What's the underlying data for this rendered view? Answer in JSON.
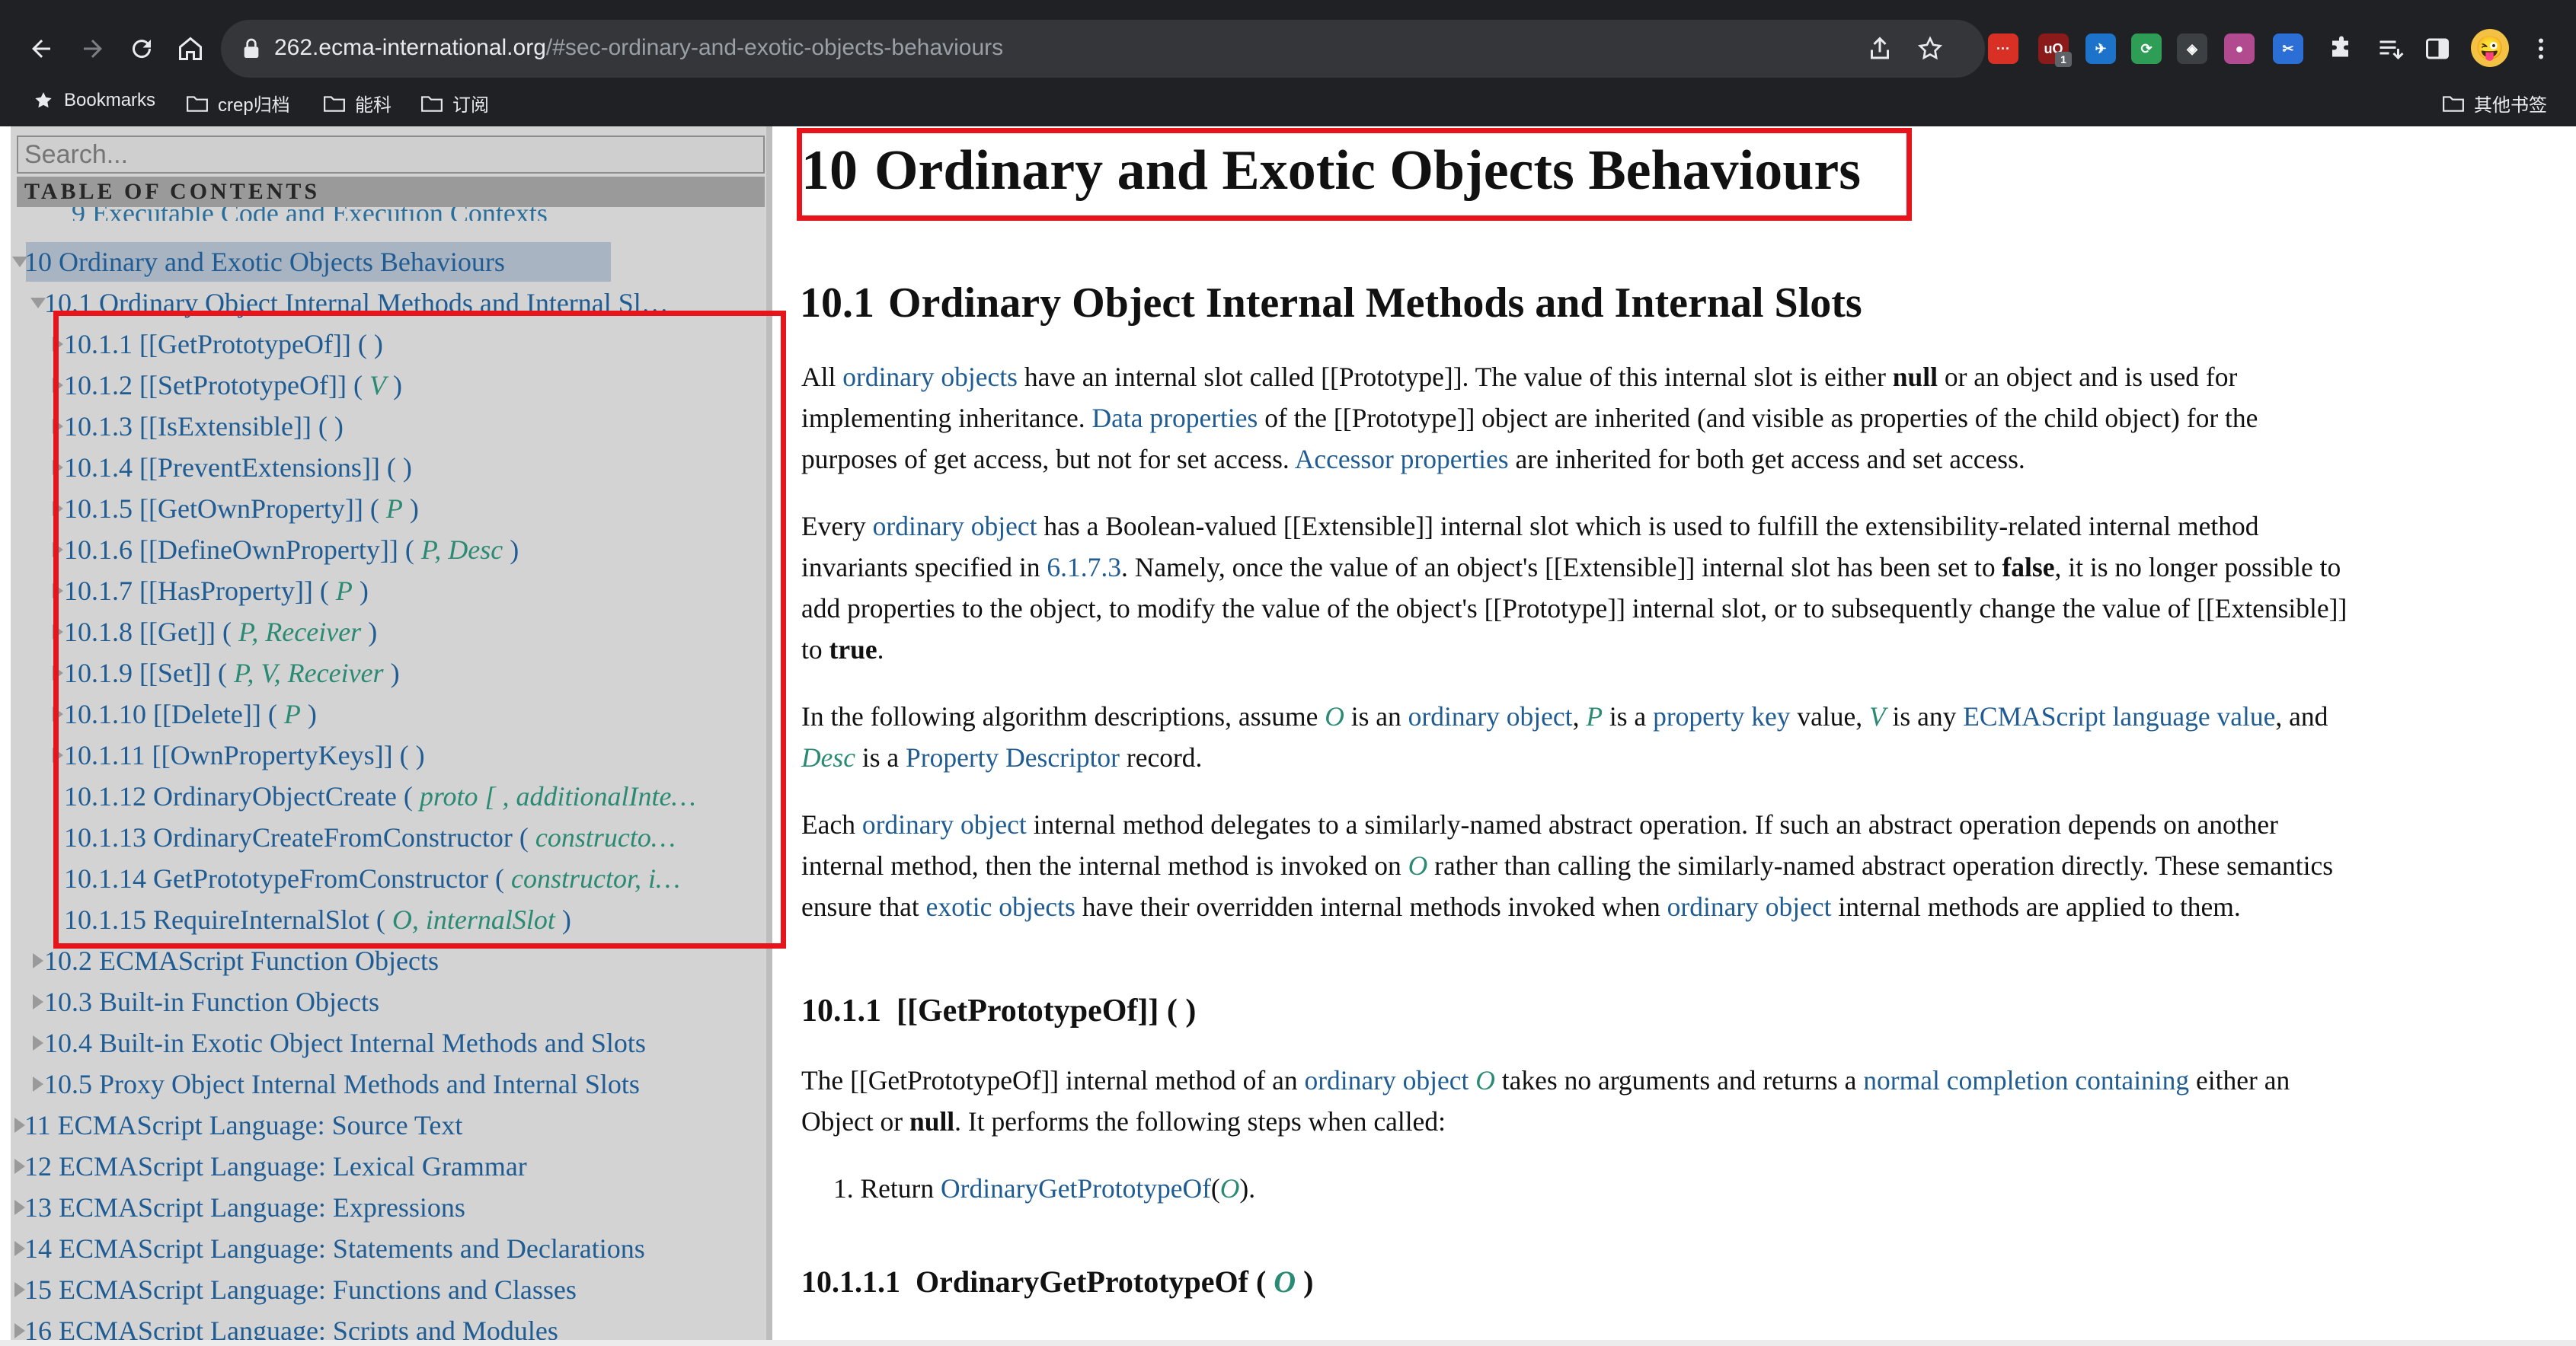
{
  "browser": {
    "url_host": "262.ecma-international.org",
    "url_path": "/#sec-ordinary-and-exotic-objects-behaviours",
    "extension_badge": "1",
    "extensions": [
      {
        "name": "extension-red",
        "label": "···",
        "color": "#d93025"
      },
      {
        "name": "extension-ublock",
        "label": "uO",
        "color": "#8b1a1a"
      },
      {
        "name": "extension-blue-bird",
        "label": "✈",
        "color": "#1d72c9"
      },
      {
        "name": "extension-green-swirl",
        "label": "⟳",
        "color": "#2e9e57"
      },
      {
        "name": "extension-dark-square",
        "label": "◈",
        "color": "#3c4043"
      },
      {
        "name": "extension-pink-dot",
        "label": "●",
        "color": "#b14a8f"
      },
      {
        "name": "extension-scissors",
        "label": "✂",
        "color": "#2b6fd6"
      }
    ],
    "avatar": "😜",
    "bookmarks": [
      {
        "label": "Bookmarks",
        "icon": "star-icon"
      },
      {
        "label": "crep归档",
        "icon": "folder-icon"
      },
      {
        "label": "能科",
        "icon": "folder-icon"
      },
      {
        "label": "订阅",
        "icon": "folder-icon"
      }
    ],
    "other_bookmarks": "其他书签"
  },
  "sidebar": {
    "search_placeholder": "Search...",
    "toc_title": "TABLE OF CONTENTS",
    "cut_item": "9 Executable Code and Execution Contexts",
    "items": [
      {
        "number": "10",
        "title": "Ordinary and Exotic Objects Behaviours",
        "level": 0,
        "arrow": "expanded",
        "active": true
      },
      {
        "number": "10.1",
        "title": "Ordinary Object Internal Methods and Internal Sl…",
        "level": 1,
        "arrow": "expanded"
      },
      {
        "number": "10.1.1",
        "title": "[[GetPrototypeOf]]",
        "args": "( )",
        "level": 2,
        "arrow": "collapsed"
      },
      {
        "number": "10.1.2",
        "title": "[[SetPrototypeOf]]",
        "args_open": "( ",
        "params": "V",
        "args_close": " )",
        "level": 2,
        "arrow": "collapsed"
      },
      {
        "number": "10.1.3",
        "title": "[[IsExtensible]]",
        "args": "( )",
        "level": 2,
        "arrow": "collapsed"
      },
      {
        "number": "10.1.4",
        "title": "[[PreventExtensions]]",
        "args": "( )",
        "level": 2,
        "arrow": "collapsed"
      },
      {
        "number": "10.1.5",
        "title": "[[GetOwnProperty]]",
        "args_open": "( ",
        "params": "P",
        "args_close": " )",
        "level": 2,
        "arrow": "collapsed"
      },
      {
        "number": "10.1.6",
        "title": "[[DefineOwnProperty]]",
        "args_open": "( ",
        "params": "P, Desc",
        "args_close": " )",
        "level": 2,
        "arrow": "collapsed"
      },
      {
        "number": "10.1.7",
        "title": "[[HasProperty]]",
        "args_open": "( ",
        "params": "P",
        "args_close": " )",
        "level": 2,
        "arrow": "collapsed"
      },
      {
        "number": "10.1.8",
        "title": "[[Get]]",
        "args_open": "( ",
        "params": "P, Receiver",
        "args_close": " )",
        "level": 2,
        "arrow": "collapsed"
      },
      {
        "number": "10.1.9",
        "title": "[[Set]]",
        "args_open": "( ",
        "params": "P, V, Receiver",
        "args_close": " )",
        "level": 2,
        "arrow": "collapsed"
      },
      {
        "number": "10.1.10",
        "title": "[[Delete]]",
        "args_open": "( ",
        "params": "P",
        "args_close": " )",
        "level": 2,
        "arrow": "collapsed"
      },
      {
        "number": "10.1.11",
        "title": "[[OwnPropertyKeys]]",
        "args": "( )",
        "level": 2,
        "arrow": "collapsed"
      },
      {
        "number": "10.1.12",
        "title": "OrdinaryObjectCreate",
        "args_open": "( ",
        "params": "proto [ , additionalInte…",
        "args_close": "",
        "level": 2,
        "arrow": "none"
      },
      {
        "number": "10.1.13",
        "title": "OrdinaryCreateFromConstructor",
        "args_open": "( ",
        "params": "constructo…",
        "args_close": "",
        "level": 2,
        "arrow": "none"
      },
      {
        "number": "10.1.14",
        "title": "GetPrototypeFromConstructor",
        "args_open": "( ",
        "params": "constructor, i…",
        "args_close": "",
        "level": 2,
        "arrow": "none"
      },
      {
        "number": "10.1.15",
        "title": "RequireInternalSlot",
        "args_open": "( ",
        "params": "O, internalSlot",
        "args_close": " )",
        "level": 2,
        "arrow": "none"
      },
      {
        "number": "10.2",
        "title": "ECMAScript Function Objects",
        "level": 1,
        "arrow": "collapsed"
      },
      {
        "number": "10.3",
        "title": "Built-in Function Objects",
        "level": 1,
        "arrow": "collapsed"
      },
      {
        "number": "10.4",
        "title": "Built-in Exotic Object Internal Methods and Slots",
        "level": 1,
        "arrow": "collapsed"
      },
      {
        "number": "10.5",
        "title": "Proxy Object Internal Methods and Internal Slots",
        "level": 1,
        "arrow": "collapsed"
      },
      {
        "number": "11",
        "title": "ECMAScript Language: Source Text",
        "level": 0,
        "arrow": "collapsed"
      },
      {
        "number": "12",
        "title": "ECMAScript Language: Lexical Grammar",
        "level": 0,
        "arrow": "collapsed"
      },
      {
        "number": "13",
        "title": "ECMAScript Language: Expressions",
        "level": 0,
        "arrow": "collapsed"
      },
      {
        "number": "14",
        "title": "ECMAScript Language: Statements and Declarations",
        "level": 0,
        "arrow": "collapsed"
      },
      {
        "number": "15",
        "title": "ECMAScript Language: Functions and Classes",
        "level": 0,
        "arrow": "collapsed"
      },
      {
        "number": "16",
        "title": "ECMAScript Language: Scripts and Modules",
        "level": 0,
        "arrow": "collapsed"
      }
    ]
  },
  "content": {
    "h1_number": "10",
    "h1_title": "Ordinary and Exotic Objects Behaviours",
    "h2_number": "10.1",
    "h2_title": "Ordinary Object Internal Methods and Internal Slots",
    "p1": [
      [
        "All ",
        {
          "link": "ordinary objects"
        },
        " have an internal slot called [[Prototype]]. The value of this internal slot is either ",
        {
          "bold": "null"
        },
        " or an object and is used for"
      ],
      [
        "implementing inheritance. ",
        {
          "link": "Data properties"
        },
        " of the [[Prototype]] object are inherited (and visible as properties of the child object) for the"
      ],
      [
        "purposes of get access, but not for set access. ",
        {
          "link": "Accessor properties"
        },
        " are inherited for both get access and set access."
      ]
    ],
    "p2": [
      [
        "Every ",
        {
          "link": "ordinary object"
        },
        " has a Boolean-valued [[Extensible]] internal slot which is used to fulfill the extensibility-related internal method"
      ],
      [
        "invariants specified in ",
        {
          "link": "6.1.7.3"
        },
        ". Namely, once the value of an object's [[Extensible]] internal slot has been set to ",
        {
          "bold": "false"
        },
        ", it is no longer possible to"
      ],
      [
        "add properties to the object, to modify the value of the object's [[Prototype]] internal slot, or to subsequently change the value of [[Extensible]]"
      ],
      [
        "to ",
        {
          "bold": "true"
        },
        "."
      ]
    ],
    "p3": [
      [
        "In the following algorithm descriptions, assume ",
        {
          "var": "O"
        },
        " is an ",
        {
          "link": "ordinary object"
        },
        ", ",
        {
          "var": "P"
        },
        " is a ",
        {
          "link": "property key"
        },
        " value, ",
        {
          "var": "V"
        },
        " is any ",
        {
          "link": "ECMAScript language value"
        },
        ", and"
      ],
      [
        {
          "var": "Desc"
        },
        " is a ",
        {
          "link": "Property Descriptor"
        },
        " record."
      ]
    ],
    "p4": [
      [
        "Each ",
        {
          "link": "ordinary object"
        },
        " internal method delegates to a similarly-named abstract operation. If such an abstract operation depends on another"
      ],
      [
        "internal method, then the internal method is invoked on ",
        {
          "var": "O"
        },
        " rather than calling the similarly-named abstract operation directly. These semantics"
      ],
      [
        "ensure that ",
        {
          "link": "exotic objects"
        },
        " have their overridden internal methods invoked when ",
        {
          "link": "ordinary object"
        },
        " internal methods are applied to them."
      ]
    ],
    "h3_number": "10.1.1",
    "h3_title": "[[GetPrototypeOf]] ( )",
    "p5": [
      [
        "The [[GetPrototypeOf]] internal method of an ",
        {
          "link": "ordinary object"
        },
        " ",
        {
          "var": "O"
        },
        " takes no arguments and returns a ",
        {
          "link": "normal completion containing"
        },
        " either an"
      ],
      [
        "Object or ",
        {
          "bold": "null"
        },
        ". It performs the following steps when called:"
      ]
    ],
    "step1": [
      [
        "1. Return ",
        {
          "link": "OrdinaryGetPrototypeOf"
        },
        "(",
        {
          "var": "O"
        },
        ")."
      ]
    ],
    "h4_number": "10.1.1.1",
    "h4_title_before": "OrdinaryGetPrototypeOf ( ",
    "h4_param": "O",
    "h4_title_after": " )"
  },
  "colors": {
    "link": "#1f5c93",
    "variable": "#2a8a73",
    "annotation_red": "#e8141c",
    "sidebar_bg": "#d3d3d3"
  }
}
